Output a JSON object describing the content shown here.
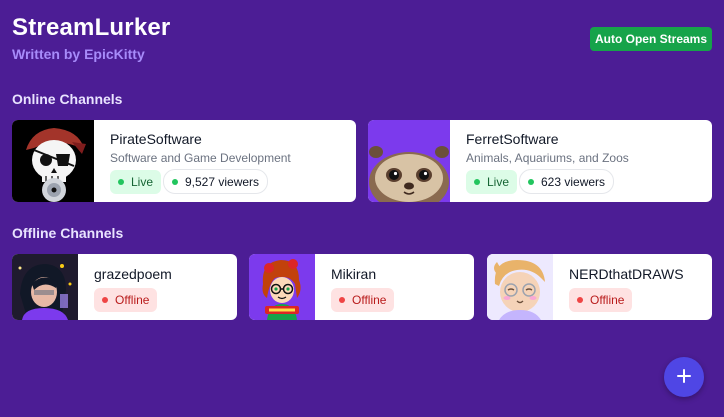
{
  "header": {
    "title": "StreamLurker",
    "subtitle": "Written by EpicKitty",
    "auto_open_label": "Auto Open Streams"
  },
  "online": {
    "heading": "Online Channels",
    "channels": [
      {
        "name": "PirateSoftware",
        "description": "Software and Game Development",
        "status": "Live",
        "viewers": "9,527 viewers",
        "avatar_icon": "pirate-skull-icon"
      },
      {
        "name": "FerretSoftware",
        "description": "Animals, Aquariums, and Zoos",
        "status": "Live",
        "viewers": "623 viewers",
        "avatar_icon": "ferret-face-icon"
      }
    ]
  },
  "offline": {
    "heading": "Offline Channels",
    "channels": [
      {
        "name": "grazedpoem",
        "status": "Offline",
        "avatar_icon": "grazedpoem-avatar"
      },
      {
        "name": "Mikiran",
        "status": "Offline",
        "avatar_icon": "mikiran-avatar"
      },
      {
        "name": "NERDthatDRAWS",
        "status": "Offline",
        "avatar_icon": "nerdthatdraws-avatar"
      }
    ]
  },
  "fab": {
    "icon": "plus-icon"
  },
  "colors": {
    "background": "#4c1d95",
    "accent_green": "#16a34a",
    "live_dot": "#22c55e",
    "offline_dot": "#ef4444",
    "fab": "#4f46e5"
  }
}
